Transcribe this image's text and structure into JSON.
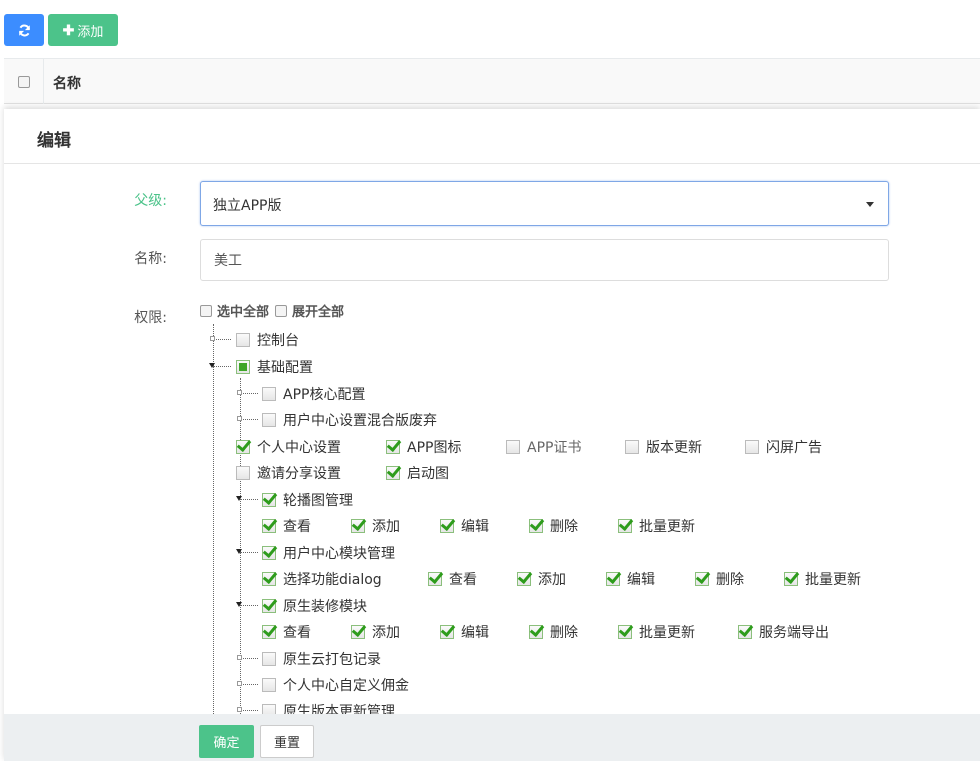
{
  "toolbar": {
    "refresh_icon": "refresh-icon",
    "add_label": "添加"
  },
  "table": {
    "name_header": "名称"
  },
  "modal": {
    "title": "编辑",
    "parent_label": "父级:",
    "parent_value": "独立APP版",
    "name_label": "名称:",
    "name_value": "美工",
    "perm_label": "权限:",
    "select_all": "选中全部",
    "expand_all": "展开全部",
    "ok_label": "确定",
    "reset_label": "重置"
  },
  "tree": {
    "console": "控制台",
    "basic_config": "基础配置",
    "app_core_config": "APP核心配置",
    "user_center_mixed": "用户中心设置混合版废弃",
    "row_a": [
      "个人中心设置",
      "APP图标",
      "APP证书",
      "版本更新",
      "闪屏广告"
    ],
    "row_b": [
      "邀请分享设置",
      "启动图"
    ],
    "carousel": "轮播图管理",
    "carousel_actions": [
      "查看",
      "添加",
      "编辑",
      "删除",
      "批量更新"
    ],
    "user_module": "用户中心模块管理",
    "user_module_actions": [
      "选择功能dialog",
      "查看",
      "添加",
      "编辑",
      "删除",
      "批量更新"
    ],
    "native_decor": "原生装修模块",
    "native_decor_actions": [
      "查看",
      "添加",
      "编辑",
      "删除",
      "批量更新",
      "服务端导出"
    ],
    "cloud_pack": "原生云打包记录",
    "custom_commission": "个人中心自定义佣金",
    "native_version": "原生版本更新管理"
  }
}
